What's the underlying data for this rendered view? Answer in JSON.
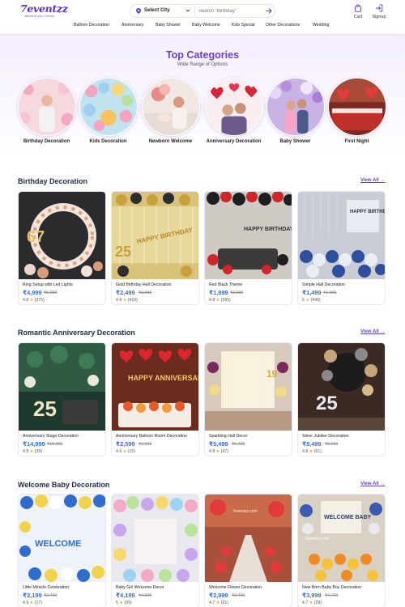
{
  "brand": {
    "name": "7eventzz",
    "tagline": "Moments you Cherish"
  },
  "search": {
    "city_label": "Select City",
    "placeholder": "Search \"Birthday\""
  },
  "header": {
    "cart_label": "Cart",
    "signup_label": "Signup"
  },
  "nav": [
    "Balloon Decoration",
    "Anniversary",
    "Baby Shower",
    "Baby Welcome",
    "Kids Special",
    "Other Decorations",
    "Wedding"
  ],
  "top_categories": {
    "title": "Top Categories",
    "subtitle": "Wide Range of Options",
    "items": [
      {
        "label": "Birthday Decoration"
      },
      {
        "label": "Kids Decoration"
      },
      {
        "label": "Newborn Welcome"
      },
      {
        "label": "Anniversary Decoration"
      },
      {
        "label": "Baby Shower"
      },
      {
        "label": "First Night"
      }
    ]
  },
  "sections": [
    {
      "title": "Birthday Decoration",
      "view_all": "View All →",
      "products": [
        {
          "name": "Ring Setup with Led Lights",
          "price": "₹4,999",
          "mrp": "₹5,999",
          "rating": "4.8",
          "reviews": "(375)"
        },
        {
          "name": "Gold Birthday Hall Decoration",
          "price": "₹2,499",
          "mrp": "₹2,999",
          "rating": "4.9",
          "reviews": "(410)"
        },
        {
          "name": "Red Black Theme",
          "price": "₹1,899",
          "mrp": "₹2,299",
          "rating": "4.8",
          "reviews": "(395)"
        },
        {
          "name": "Simple Hall Decoration",
          "price": "₹1,499",
          "mrp": "₹1,999",
          "rating": "5",
          "reviews": "(449)"
        }
      ]
    },
    {
      "title": "Romantic Anniversary Decoration",
      "view_all": "View All →",
      "products": [
        {
          "name": "Anniversary Stage Decoration",
          "price": "₹14,999",
          "mrp": "₹16,999",
          "rating": "4.5",
          "reviews": "(39)"
        },
        {
          "name": "Anniversary Balloon Room Decoration",
          "price": "₹2,599",
          "mrp": "₹2,999",
          "rating": "4.6",
          "reviews": "(15)"
        },
        {
          "name": "Sparkling Hall Decor",
          "price": "₹5,499",
          "mrp": "₹6,499",
          "rating": "4.8",
          "reviews": "(47)"
        },
        {
          "name": "Silver Jubilee Decoration",
          "price": "₹8,499",
          "mrp": "₹9,999",
          "rating": "4.8",
          "reviews": "(61)"
        }
      ]
    },
    {
      "title": "Welcome Baby Decoration",
      "view_all": "View All →",
      "products": [
        {
          "name": "Little Miracle Celebration",
          "price": "₹2,199",
          "mrp": "₹2,499",
          "rating": "4.9",
          "reviews": "(17)"
        },
        {
          "name": "Baby Girl Welcome Decor",
          "price": "₹4,199",
          "mrp": "₹4,999",
          "rating": "5",
          "reviews": "(99)"
        },
        {
          "name": "Welcome Flower Decoration",
          "price": "₹2,999",
          "mrp": "₹3,499",
          "rating": "4.7",
          "reviews": "(21)"
        },
        {
          "name": "New Born Baby Boy Decoration",
          "price": "₹3,999",
          "mrp": "₹4,799",
          "rating": "4.7",
          "reviews": "(29)"
        }
      ]
    }
  ],
  "image_text": {
    "birthday": "HAPPY BIRTHDAY",
    "anniversary": "HAPPY ANNIVERSARY",
    "welcome": "WELCOME",
    "welcome_baby": "WELCOME BABY",
    "watermark": "7eventzz.com",
    "n67": "67",
    "n25": "25",
    "n19": "19"
  },
  "colors": {
    "brand": "#6a3fcf",
    "price": "#3a6ed6",
    "star": "#f5a623",
    "title": "#1f2a44"
  }
}
